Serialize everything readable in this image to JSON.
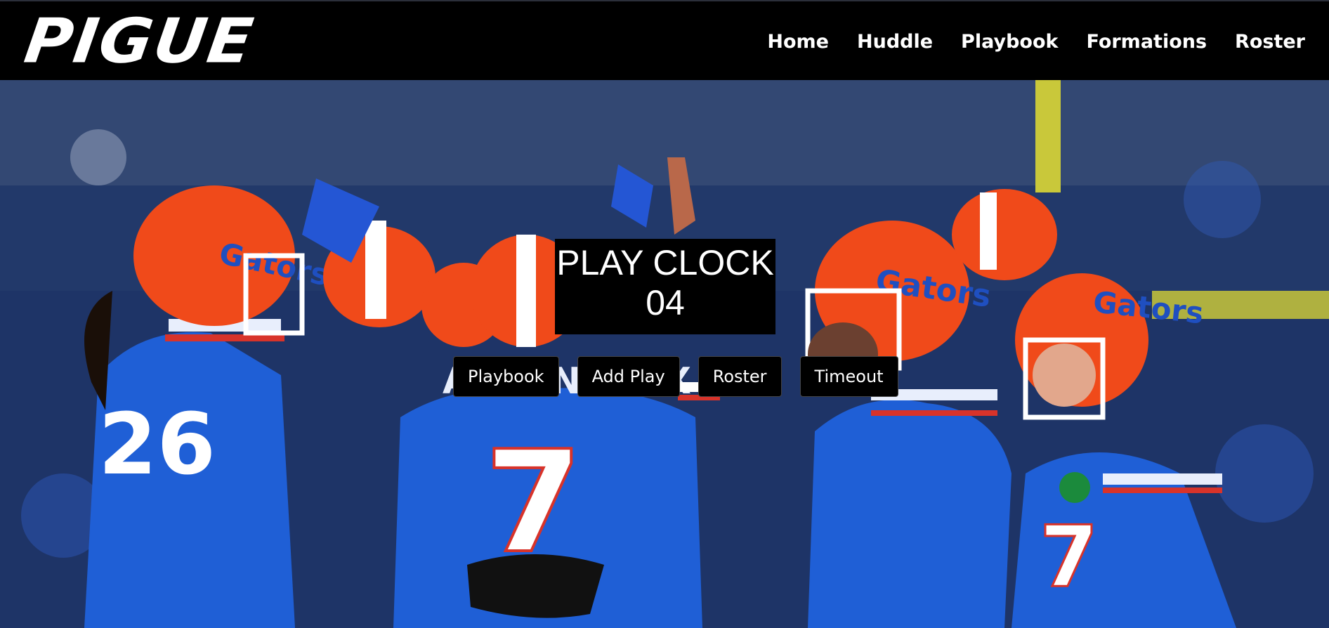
{
  "brand": {
    "logo_text": "PIGUE"
  },
  "nav": {
    "items": [
      {
        "label": "Home"
      },
      {
        "label": "Huddle"
      },
      {
        "label": "Playbook"
      },
      {
        "label": "Formations"
      },
      {
        "label": "Roster"
      }
    ]
  },
  "play_clock": {
    "title": "PLAY CLOCK",
    "value": "04"
  },
  "actions": {
    "buttons": [
      {
        "label": "Playbook"
      },
      {
        "label": "Add Play"
      },
      {
        "label": "Roster"
      },
      {
        "label": "Timeout"
      }
    ]
  },
  "hero": {
    "jersey_name": "ARCENEAUX",
    "jersey_number": "7",
    "helmet_text": "Gators",
    "colors": {
      "jersey_blue": "#1f5fd6",
      "helmet_orange": "#f04a1a",
      "stripe_red": "#d8332a"
    }
  }
}
